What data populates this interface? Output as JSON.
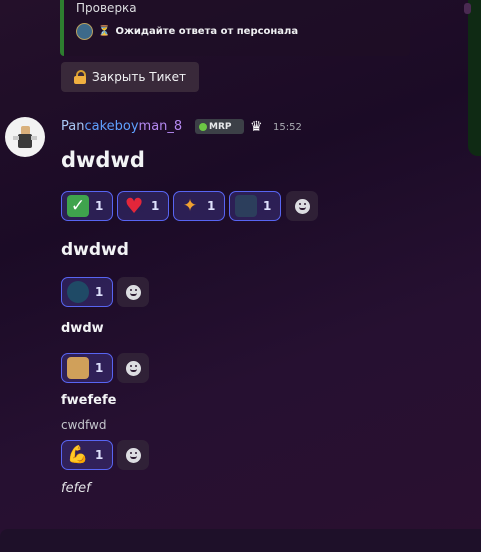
{
  "ticket": {
    "embed_title": "Проверка",
    "status_text": "Ожидайте ответа от персонала",
    "status_icon": "hourglass-icon",
    "close_button_label": "Закрыть Тикет",
    "close_button_icon": "lock-icon"
  },
  "message": {
    "author_part1": "Pan",
    "author_part2": "cakeboy",
    "author_part3": "man_8",
    "badge_text": "MRP",
    "timestamp": "15:52",
    "lines": [
      "dwdwd",
      "dwdwd",
      "dwdw",
      "fwefefe",
      "cwdfwd",
      "fefef"
    ]
  },
  "reactions": {
    "row1": [
      {
        "emoji": "check-mark",
        "count": "1"
      },
      {
        "emoji": "heart",
        "count": "1"
      },
      {
        "emoji": "party-popper",
        "count": "1"
      },
      {
        "emoji": "custom-emoji",
        "count": "1"
      }
    ],
    "row2": [
      {
        "emoji": "shield-emblem",
        "count": "1"
      }
    ],
    "row3": [
      {
        "emoji": "doge",
        "count": "1"
      }
    ],
    "row4": [
      {
        "emoji": "flexed-biceps",
        "count": "1"
      }
    ]
  },
  "colors": {
    "reaction_border": "#5865f2",
    "embed_accent": "#2d7d2f",
    "timestamp": "#a9abb1"
  }
}
